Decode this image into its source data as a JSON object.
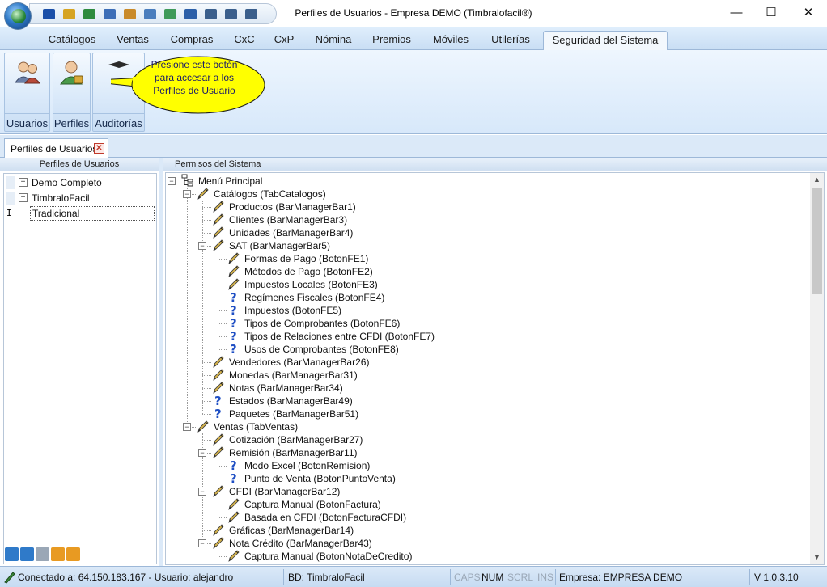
{
  "window": {
    "title": "Perfiles de Usuarios - Empresa DEMO (Timbralofacil®)",
    "minimize_icon": "—",
    "maximize_icon": "☐",
    "close_icon": "✕"
  },
  "quick_access": [
    {
      "name": "info-icon",
      "color": "#1b4fa8"
    },
    {
      "name": "key-icon",
      "color": "#d6a422"
    },
    {
      "name": "money-icon",
      "color": "#2e8b3e"
    },
    {
      "name": "card-icon",
      "color": "#3d6eb7"
    },
    {
      "name": "invoice-icon",
      "color": "#c98a2a"
    },
    {
      "name": "document-icon",
      "color": "#4a7dbd"
    },
    {
      "name": "image-icon",
      "color": "#3f9a5a"
    },
    {
      "name": "eye-icon",
      "color": "#2c5fa8"
    },
    {
      "name": "cascade-windows-icon",
      "color": "#3b5f8c"
    },
    {
      "name": "tile-horizontal-icon",
      "color": "#3b5f8c"
    },
    {
      "name": "tile-vertical-icon",
      "color": "#3b5f8c"
    }
  ],
  "ribbon": {
    "tabs": [
      "Catálogos",
      "Ventas",
      "Compras",
      "CxC",
      "CxP",
      "Nómina",
      "Premios",
      "Móviles",
      "Utilerías",
      "Seguridad del Sistema"
    ],
    "active_tab": "Seguridad del Sistema",
    "buttons": [
      {
        "label": "Usuarios",
        "icon": "users-icon"
      },
      {
        "label": "Perfiles",
        "icon": "user-profile-icon"
      },
      {
        "label": "Auditorías",
        "icon": "audit-icon"
      }
    ],
    "mdi_controls": {
      "minimize": "–",
      "restore": "❐",
      "close": "✕"
    }
  },
  "callout": {
    "lines": [
      "Presione este botón",
      "para accesar a los",
      "Perfiles de Usuario"
    ],
    "fill": "#ffff00"
  },
  "doc_tabs": [
    {
      "label": "Perfiles de Usuarios",
      "close": "✕"
    }
  ],
  "left_panel": {
    "header": "Perfiles de Usuarios",
    "profiles": [
      {
        "name": "Demo Completo",
        "expander": "+"
      },
      {
        "name": "TimbraloFacil",
        "expander": "+"
      },
      {
        "name": "Tradicional",
        "expander": ""
      }
    ],
    "edit_cursor": "I",
    "tools": [
      {
        "name": "add-profile-icon",
        "color": "#2f7ac9"
      },
      {
        "name": "delete-profile-icon",
        "color": "#2f7ac9"
      },
      {
        "name": "edit-profile-icon",
        "color": "#9aa7b6"
      },
      {
        "name": "accept-icon",
        "color": "#e89a22"
      },
      {
        "name": "cancel-icon",
        "color": "#e89a22"
      }
    ]
  },
  "right_panel": {
    "header": "Permisos del Sistema",
    "tree": [
      {
        "label": "Menú Principal",
        "level": 0,
        "icon": "tree-root",
        "expander": "-"
      },
      {
        "label": "Catálogos (TabCatalogos)",
        "level": 1,
        "icon": "pen",
        "expander": "-"
      },
      {
        "label": "Productos (BarManagerBar1)",
        "level": 2,
        "icon": "pen",
        "expander": ""
      },
      {
        "label": "Clientes (BarManagerBar3)",
        "level": 2,
        "icon": "pen",
        "expander": ""
      },
      {
        "label": "Unidades (BarManagerBar4)",
        "level": 2,
        "icon": "pen",
        "expander": ""
      },
      {
        "label": "SAT (BarManagerBar5)",
        "level": 2,
        "icon": "pen",
        "expander": "-"
      },
      {
        "label": "Formas de Pago (BotonFE1)",
        "level": 3,
        "icon": "pen",
        "expander": ""
      },
      {
        "label": "Métodos de Pago (BotonFE2)",
        "level": 3,
        "icon": "pen",
        "expander": ""
      },
      {
        "label": "Impuestos Locales (BotonFE3)",
        "level": 3,
        "icon": "pen",
        "expander": ""
      },
      {
        "label": "Regímenes Fiscales (BotonFE4)",
        "level": 3,
        "icon": "question",
        "expander": ""
      },
      {
        "label": "Impuestos (BotonFE5)",
        "level": 3,
        "icon": "question",
        "expander": ""
      },
      {
        "label": "Tipos de Comprobantes (BotonFE6)",
        "level": 3,
        "icon": "question",
        "expander": ""
      },
      {
        "label": "Tipos de Relaciones entre CFDI (BotonFE7)",
        "level": 3,
        "icon": "question",
        "expander": ""
      },
      {
        "label": "Usos de Comprobantes (BotonFE8)",
        "level": 3,
        "icon": "question",
        "expander": ""
      },
      {
        "label": "Vendedores (BarManagerBar26)",
        "level": 2,
        "icon": "pen",
        "expander": ""
      },
      {
        "label": "Monedas (BarManagerBar31)",
        "level": 2,
        "icon": "pen",
        "expander": ""
      },
      {
        "label": "Notas (BarManagerBar34)",
        "level": 2,
        "icon": "pen",
        "expander": ""
      },
      {
        "label": "Estados (BarManagerBar49)",
        "level": 2,
        "icon": "question",
        "expander": ""
      },
      {
        "label": "Paquetes (BarManagerBar51)",
        "level": 2,
        "icon": "question",
        "expander": ""
      },
      {
        "label": "Ventas (TabVentas)",
        "level": 1,
        "icon": "pen",
        "expander": "-"
      },
      {
        "label": "Cotización (BarManagerBar27)",
        "level": 2,
        "icon": "pen",
        "expander": ""
      },
      {
        "label": "Remisión (BarManagerBar11)",
        "level": 2,
        "icon": "pen",
        "expander": "-"
      },
      {
        "label": "Modo Excel (BotonRemision)",
        "level": 3,
        "icon": "question",
        "expander": ""
      },
      {
        "label": "Punto de Venta (BotonPuntoVenta)",
        "level": 3,
        "icon": "question",
        "expander": ""
      },
      {
        "label": "CFDI (BarManagerBar12)",
        "level": 2,
        "icon": "pen",
        "expander": "-"
      },
      {
        "label": "Captura Manual (BotonFactura)",
        "level": 3,
        "icon": "pen",
        "expander": ""
      },
      {
        "label": "Basada en CFDI (BotonFacturaCFDI)",
        "level": 3,
        "icon": "pen",
        "expander": ""
      },
      {
        "label": "Gráficas (BarManagerBar14)",
        "level": 2,
        "icon": "pen",
        "expander": ""
      },
      {
        "label": "Nota Crédito (BarManagerBar43)",
        "level": 2,
        "icon": "pen",
        "expander": "-"
      },
      {
        "label": "Captura Manual (BotonNotaDeCredito)",
        "level": 3,
        "icon": "pen",
        "expander": ""
      }
    ],
    "scroll_up": "▲",
    "scroll_down": "▼"
  },
  "statusbar": {
    "connection": "Conectado a: 64.150.183.167 - Usuario: alejandro",
    "database": "BD: TimbraloFacil",
    "caps": "CAPS",
    "num": "NUM",
    "scrl": "SCRL",
    "ins": "INS",
    "company": "Empresa: EMPRESA DEMO",
    "version": "V 1.0.3.10"
  },
  "colors": {
    "pen_icon": "#d4b24a",
    "question_icon": "#1f4fc4",
    "callout_fill": "#ffff00"
  }
}
